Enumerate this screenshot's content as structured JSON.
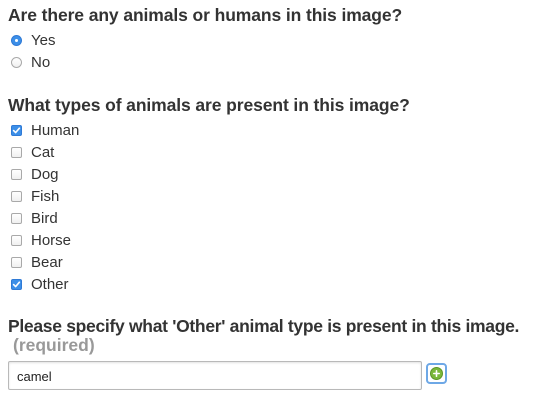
{
  "q1": {
    "title": "Are there any animals or humans in this image?",
    "options": [
      {
        "label": "Yes",
        "checked": true
      },
      {
        "label": "No",
        "checked": false
      }
    ]
  },
  "q2": {
    "title": "What types of animals are present in this image?",
    "options": [
      {
        "label": "Human",
        "checked": true
      },
      {
        "label": "Cat",
        "checked": false
      },
      {
        "label": "Dog",
        "checked": false
      },
      {
        "label": "Fish",
        "checked": false
      },
      {
        "label": "Bird",
        "checked": false
      },
      {
        "label": "Horse",
        "checked": false
      },
      {
        "label": "Bear",
        "checked": false
      },
      {
        "label": "Other",
        "checked": true
      }
    ]
  },
  "q3": {
    "title": "Please specify what 'Other' animal type is present in this image.",
    "required_label": "(required)",
    "value": "camel"
  },
  "icons": {
    "add": "plus-circle-icon"
  },
  "colors": {
    "accent": "#3c8fe8",
    "add_green": "#7ab83a",
    "required_gray": "#999999"
  }
}
